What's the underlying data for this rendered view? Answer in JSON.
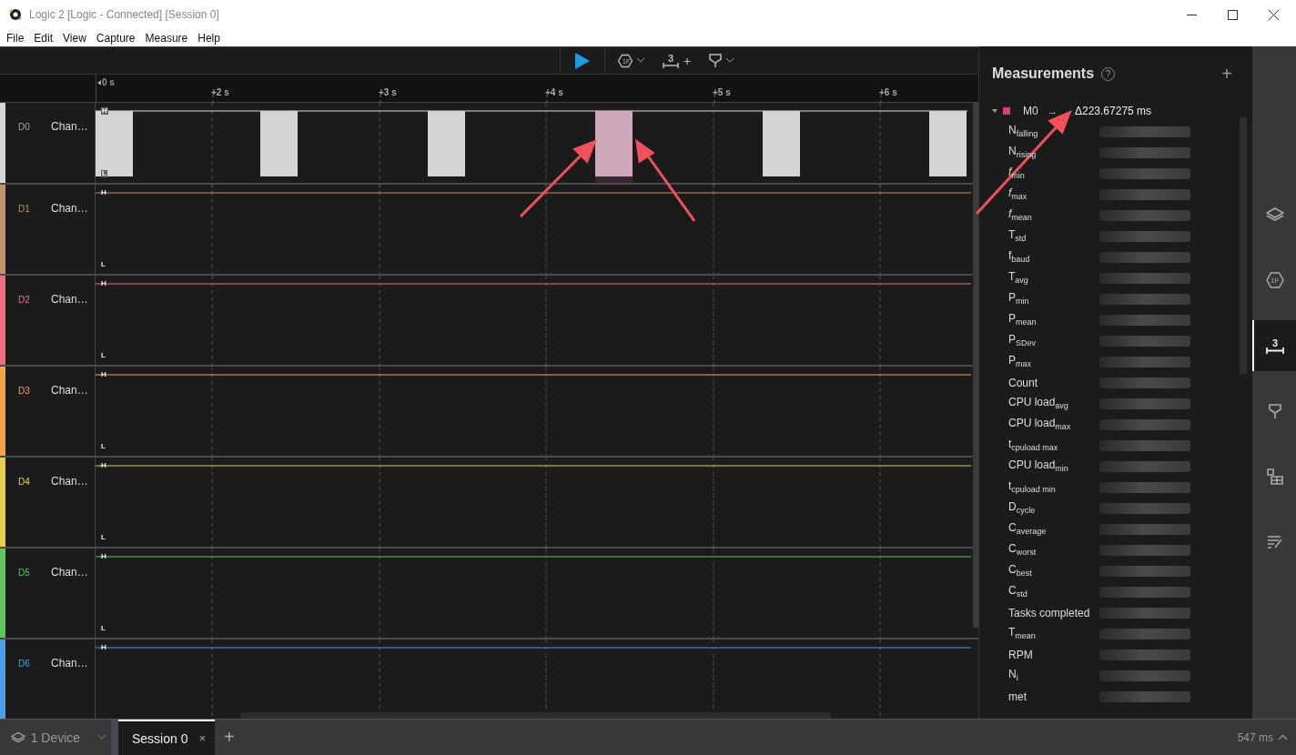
{
  "window": {
    "title": "Logic 2 [Logic - Connected] [Session 0]"
  },
  "menu": [
    "File",
    "Edit",
    "View",
    "Capture",
    "Measure",
    "Help"
  ],
  "toolbar": {
    "trigger_label": "1F",
    "measure_label": "3",
    "measure_add": "+"
  },
  "ruler": {
    "origin_label": "0 s",
    "ticks": [
      "+2 s",
      "+3 s",
      "+4 s",
      "+5 s",
      "+6 s"
    ]
  },
  "channels": [
    {
      "id": "D0",
      "name": "Chan…",
      "color": "#d4d4d4",
      "kind": "pulses",
      "high_label": "H",
      "low_label": "L"
    },
    {
      "id": "D1",
      "name": "Chan…",
      "color": "#c8906a",
      "kind": "flat_high",
      "high_label": "H",
      "low_label": "L"
    },
    {
      "id": "D2",
      "name": "Chan…",
      "color": "#f0707e",
      "kind": "flat_high",
      "high_label": "H",
      "low_label": "L"
    },
    {
      "id": "D3",
      "name": "Chan…",
      "color": "#f5a34a",
      "kind": "flat_high",
      "high_label": "H",
      "low_label": "L"
    },
    {
      "id": "D4",
      "name": "Chan…",
      "color": "#e6d24a",
      "kind": "flat_high",
      "high_label": "H",
      "low_label": "L"
    },
    {
      "id": "D5",
      "name": "Chan…",
      "color": "#5cc85c",
      "kind": "flat_high",
      "high_label": "H",
      "low_label": "L"
    },
    {
      "id": "D6",
      "name": "Chan…",
      "color": "#4a9eea",
      "kind": "flat_high",
      "high_label": "H"
    }
  ],
  "measurements": {
    "title": "Measurements",
    "help": "?",
    "add": "+",
    "entry": {
      "name": "M0",
      "color": "#d6407f",
      "expanded": true,
      "arrow": "→",
      "value": "Δ223.67275 ms"
    },
    "rows": [
      "N$_{falling}$",
      "N$_{rising}$",
      "*f*$_{min}$",
      "*f*$_{max}$",
      "*f*$_{mean}$",
      "T$_{std}$",
      "f$_{baud}$",
      "T$_{avg}$",
      "P$_{min}$",
      "P$_{mean}$",
      "P$_{SDev}$",
      "P$_{max}$",
      "Count",
      "CPU load$_{avg}$",
      "CPU load$_{max}$",
      "t$_{cpuload max}$",
      "CPU load$_{min}$",
      "t$_{cpuload min}$",
      "D$_{cycle}$",
      "C$_{average}$",
      "C$_{worst}$",
      "C$_{best}$",
      "C$_{std}$",
      "Tasks completed",
      "T$_{mean}$",
      "RPM",
      "N$_{i}$",
      "met"
    ]
  },
  "rail": [
    {
      "kind": "layers",
      "selected": false
    },
    {
      "kind": "trigger",
      "label": "1F",
      "selected": false
    },
    {
      "kind": "measure",
      "label": "3",
      "selected": true
    },
    {
      "kind": "filter",
      "selected": false
    },
    {
      "kind": "extensions",
      "selected": false
    },
    {
      "kind": "notes",
      "selected": false
    }
  ],
  "bottom": {
    "device": "1 Device",
    "sessions": [
      {
        "label": "Session 0",
        "close": "×",
        "selected": true
      }
    ],
    "add": "+",
    "timing": "547 ms"
  }
}
